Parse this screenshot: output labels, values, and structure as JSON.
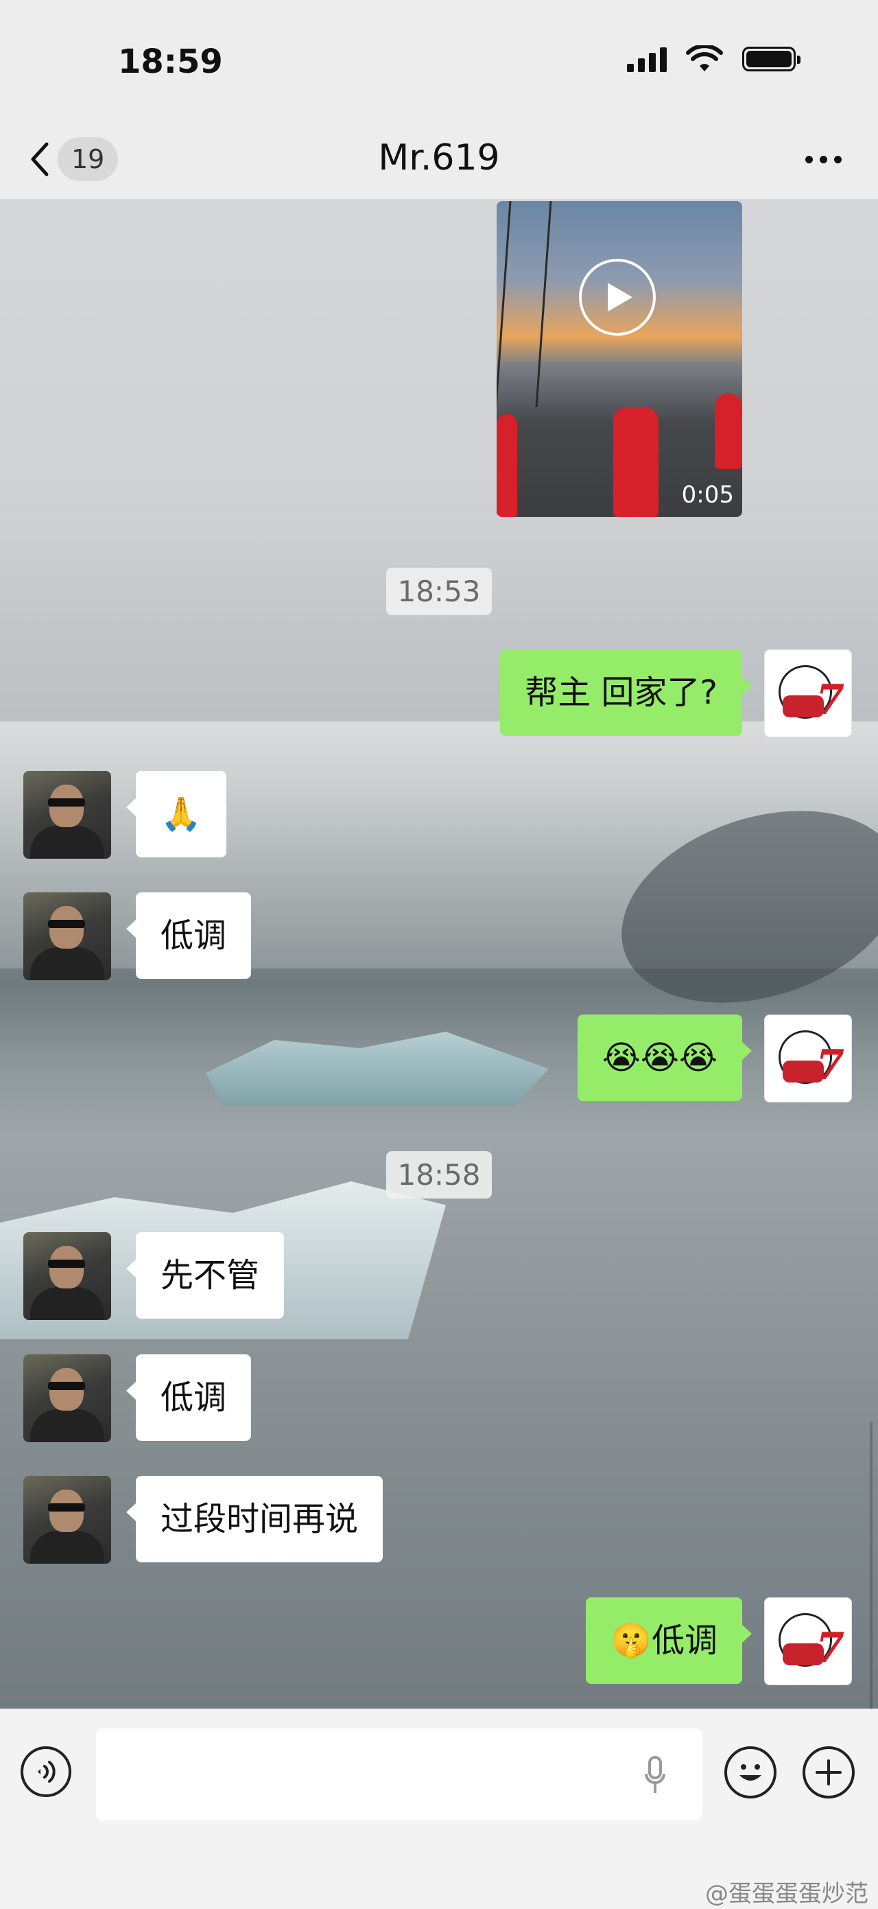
{
  "status_bar": {
    "time": "18:59"
  },
  "nav": {
    "unread_count": "19",
    "title": "Mr.619"
  },
  "video": {
    "duration": "0:05"
  },
  "timestamps": [
    "18:53",
    "18:58"
  ],
  "messages": [
    {
      "side": "right",
      "text": "帮主 回家了?"
    },
    {
      "side": "left",
      "text": "🙏"
    },
    {
      "side": "left",
      "text": "低调"
    },
    {
      "side": "right",
      "text": "😭😭😭"
    },
    {
      "side": "left",
      "text": "先不管"
    },
    {
      "side": "left",
      "text": "低调"
    },
    {
      "side": "left",
      "text": "过段时间再说"
    },
    {
      "side": "right",
      "text": "🤫低调"
    }
  ],
  "input": {
    "value": ""
  },
  "watermark": "@蛋蛋蛋蛋炒范"
}
